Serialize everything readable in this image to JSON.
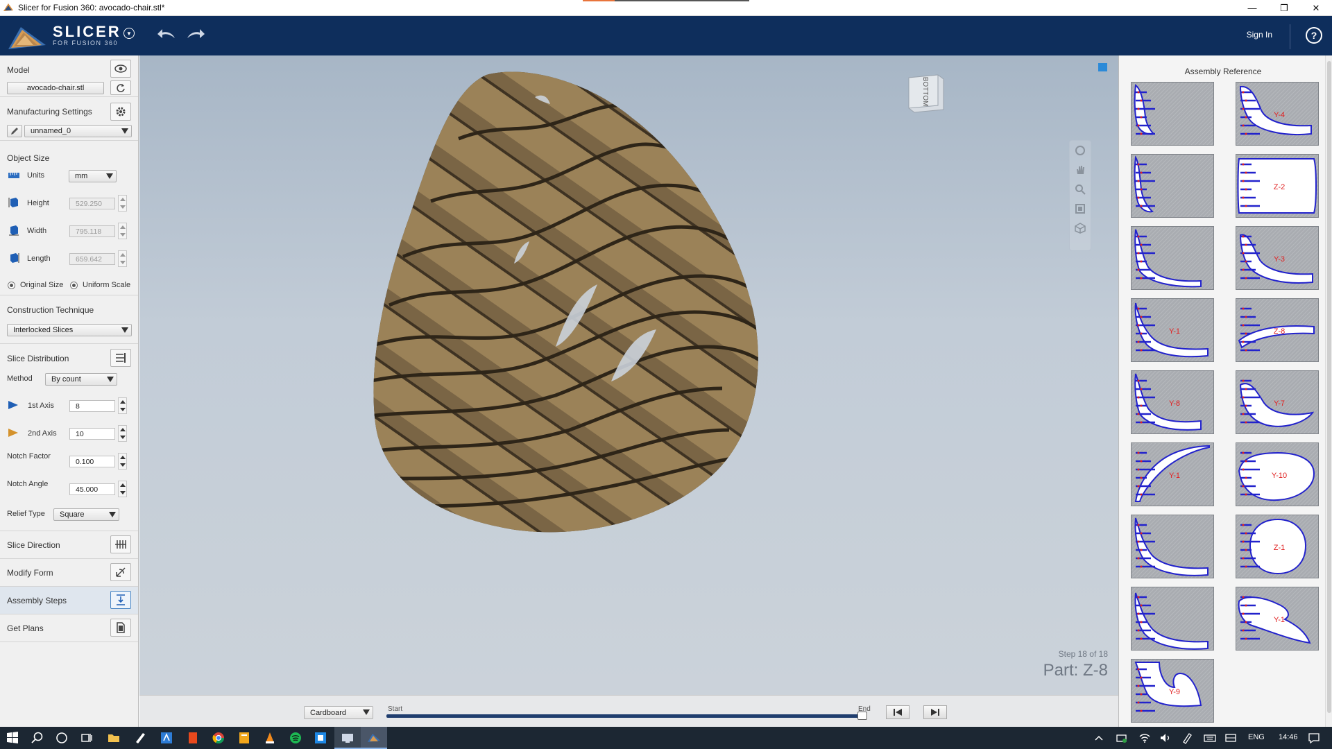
{
  "window": {
    "title": "Slicer for Fusion 360: avocado-chair.stl*",
    "controls": [
      "minimize",
      "restore",
      "close"
    ]
  },
  "header": {
    "logo_title": "SLICER",
    "logo_subtitle": "FOR FUSION 360",
    "sign_in": "Sign In",
    "help": "?"
  },
  "left_panel": {
    "model": {
      "title": "Model",
      "file_button": "avocado-chair.stl"
    },
    "manufacturing": {
      "title": "Manufacturing Settings",
      "preset": "unnamed_0"
    },
    "object_size": {
      "title": "Object Size",
      "units_label": "Units",
      "units_value": "mm",
      "height_label": "Height",
      "height_value": "529.250",
      "width_label": "Width",
      "width_value": "795.118",
      "length_label": "Length",
      "length_value": "659.642",
      "original_size": "Original Size",
      "uniform_scale": "Uniform Scale"
    },
    "construction": {
      "title": "Construction Technique",
      "value": "Interlocked Slices"
    },
    "slice_distribution": {
      "title": "Slice Distribution",
      "method_label": "Method",
      "method_value": "By count",
      "axis1_label": "1st Axis",
      "axis1_value": "8",
      "axis2_label": "2nd Axis",
      "axis2_value": "10",
      "notch_factor_label": "Notch Factor",
      "notch_factor_value": "0.100",
      "notch_angle_label": "Notch Angle",
      "notch_angle_value": "45.000",
      "relief_label": "Relief Type",
      "relief_value": "Square"
    },
    "slice_direction": "Slice Direction",
    "modify_form": "Modify Form",
    "assembly_steps": "Assembly Steps",
    "get_plans": "Get Plans"
  },
  "viewport": {
    "viewcube_face": "BOTTOM",
    "step_text": "Step 18 of 18",
    "part_text": "Part: Z-8"
  },
  "bottom_bar": {
    "material": "Cardboard",
    "slider_start": "Start",
    "slider_end": "End",
    "slider_position": 1.0
  },
  "right_panel": {
    "title": "Assembly Reference",
    "thumb_labels": [
      "",
      "Y-4",
      "",
      "Z-2",
      "",
      "Y-3",
      "Y-1",
      "Z-8",
      "Y-8",
      "Y-7",
      "Y-1",
      "Y-10",
      "",
      "Z-1",
      "",
      "Y-1",
      "Y-9"
    ]
  },
  "taskbar": {
    "language": "ENG",
    "time": "14:46"
  },
  "colors": {
    "header_bg": "#0e2e5c",
    "viewport_bg": "#c2ccd7",
    "cardboard": "#8a7550",
    "outline_blue": "#2222cc",
    "accent_red": "#e02020",
    "slider_blue": "#1f3d6e"
  }
}
